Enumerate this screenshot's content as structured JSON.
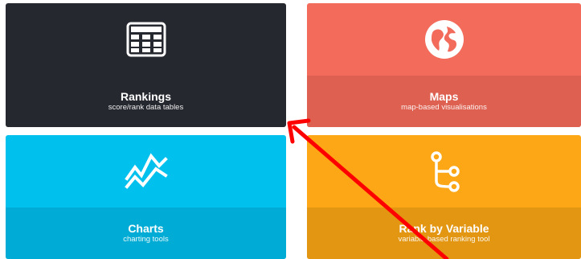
{
  "tiles": {
    "rankings": {
      "title": "Rankings",
      "subtitle": "score/rank data tables",
      "icon": "table-grid-icon"
    },
    "maps": {
      "title": "Maps",
      "subtitle": "map-based visualisations",
      "icon": "globe-icon"
    },
    "charts": {
      "title": "Charts",
      "subtitle": "charting tools",
      "icon": "line-chart-icon"
    },
    "rank_by_variable": {
      "title": "Rank by Variable",
      "subtitle": "variable-based ranking tool",
      "icon": "branch-icon"
    }
  },
  "colors": {
    "rankings_bg": "#262830",
    "maps_bg": "#f26b5b",
    "charts_bg": "#00c0ee",
    "rank_by_variable_bg": "#fda716",
    "annotation_arrow": "#ff0000"
  }
}
